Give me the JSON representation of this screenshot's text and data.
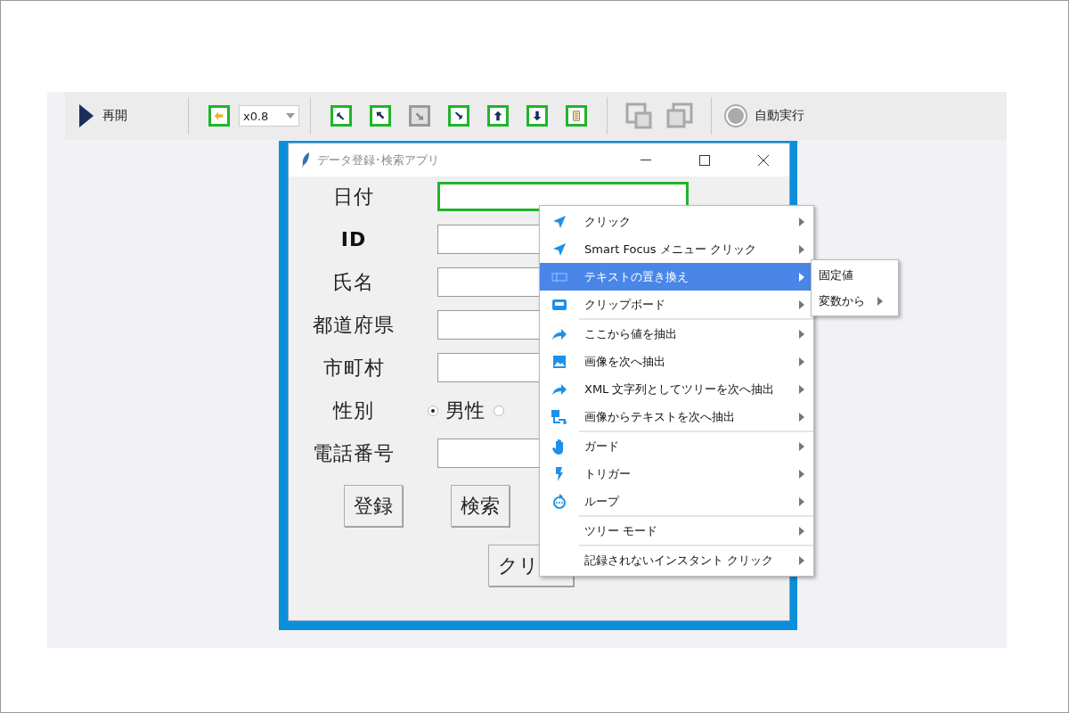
{
  "toolbar": {
    "resume": {
      "label": "再開"
    },
    "swap_button": {
      "highlighted": true
    },
    "zoom_select": {
      "value": "x0.8"
    },
    "tool_buttons": [
      {
        "kind": "arrow-up-left-edge",
        "highlighted": true
      },
      {
        "kind": "arrow-up-left",
        "highlighted": true
      },
      {
        "kind": "arrow-down-right",
        "highlighted": false
      },
      {
        "kind": "arrow-down-right-edge",
        "highlighted": true
      },
      {
        "kind": "arrow-up",
        "highlighted": true
      },
      {
        "kind": "arrow-down",
        "highlighted": true
      },
      {
        "kind": "document",
        "highlighted": true
      }
    ],
    "window_buttons": [
      {
        "kind": "window-down",
        "disabled": true
      },
      {
        "kind": "window-in",
        "disabled": true
      }
    ],
    "auto_run": {
      "label": "自動実行",
      "on": false
    }
  },
  "app_window": {
    "title": "データ登録･検索アプリ",
    "fields": [
      {
        "label": "日付",
        "focused": true
      },
      {
        "label": "ID",
        "focused": false
      },
      {
        "label": "氏名",
        "focused": false
      },
      {
        "label": "都道府県",
        "focused": false
      },
      {
        "label": "市町村",
        "focused": false
      }
    ],
    "gender": {
      "label": "性別",
      "options": [
        {
          "label": "男性",
          "selected": true
        },
        {
          "selected": false
        }
      ]
    },
    "phone": {
      "label": "電話番号",
      "focused": false
    },
    "buttons": [
      "登録",
      "検索"
    ],
    "clear_button": "クリ"
  },
  "context_menu": {
    "groups": [
      [
        {
          "kind": "send",
          "label": "クリック",
          "selected": false
        },
        {
          "kind": "send",
          "label": "Smart Focus メニュー クリック",
          "selected": false
        },
        {
          "kind": "text",
          "label": "テキストの置き換え",
          "selected": true
        },
        {
          "kind": "clipboard",
          "label": "クリップボード",
          "selected": false
        }
      ],
      [
        {
          "kind": "share",
          "label": "ここから値を抽出",
          "selected": false
        },
        {
          "kind": "image",
          "label": "画像を次へ抽出",
          "selected": false
        },
        {
          "kind": "share",
          "label": "XML 文字列としてツリーを次へ抽出",
          "selected": false
        },
        {
          "kind": "ocr",
          "label": "画像からテキストを次へ抽出",
          "selected": false
        }
      ],
      [
        {
          "kind": "hand",
          "label": "ガード",
          "selected": false
        },
        {
          "kind": "bolt",
          "label": "トリガー",
          "selected": false
        },
        {
          "kind": "loop",
          "label": "ループ",
          "selected": false
        }
      ],
      [
        {
          "label": "ツリー モード",
          "selected": false
        }
      ],
      [
        {
          "label": "記録されないインスタント クリック",
          "selected": false
        }
      ]
    ],
    "submenu": [
      {
        "label": "固定値",
        "has_submenu": false
      },
      {
        "label": "変数から",
        "has_submenu": true
      }
    ]
  }
}
